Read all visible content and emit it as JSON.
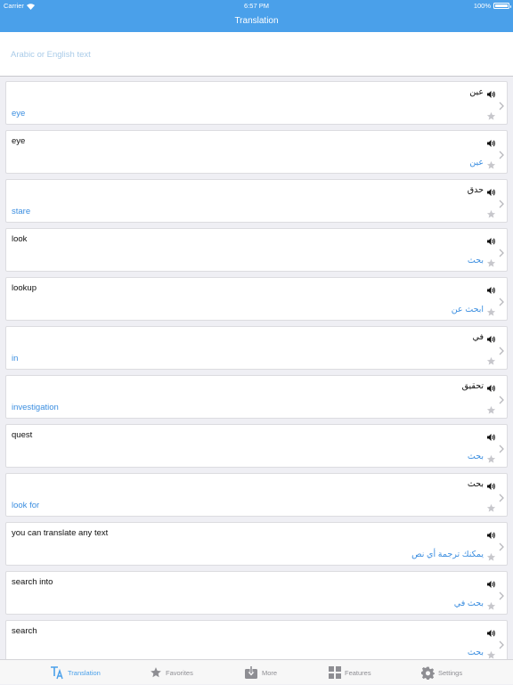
{
  "status_bar": {
    "carrier": "Carrier",
    "time": "6:57 PM",
    "battery": "100%"
  },
  "nav": {
    "title": "Translation"
  },
  "search": {
    "placeholder": "Arabic or English text",
    "value": ""
  },
  "colors": {
    "accent": "#4aa0ea",
    "translation_text": "#3b8ee0"
  },
  "entries": [
    {
      "source": "عين",
      "translation": "eye",
      "source_rtl": true
    },
    {
      "source": "eye",
      "translation": "عين",
      "source_rtl": false
    },
    {
      "source": "حدق",
      "translation": "stare",
      "source_rtl": true
    },
    {
      "source": "look",
      "translation": "بحث",
      "source_rtl": false
    },
    {
      "source": "lookup",
      "translation": "ابحث عن",
      "source_rtl": false
    },
    {
      "source": "في",
      "translation": "in",
      "source_rtl": true
    },
    {
      "source": "تحقيق",
      "translation": "investigation",
      "source_rtl": true
    },
    {
      "source": "quest",
      "translation": "بحث",
      "source_rtl": false
    },
    {
      "source": "بحث",
      "translation": "look for",
      "source_rtl": true
    },
    {
      "source": "you can translate any text",
      "translation": "يمكنك ترجمة أي نص",
      "source_rtl": false
    },
    {
      "source": "search into",
      "translation": "بحث في",
      "source_rtl": false
    },
    {
      "source": "search",
      "translation": "بحث",
      "source_rtl": false
    }
  ],
  "tabs": [
    {
      "label": "Translation",
      "icon": "translate-icon",
      "active": true
    },
    {
      "label": "Favorites",
      "icon": "star-icon",
      "active": false
    },
    {
      "label": "More",
      "icon": "download-icon",
      "active": false
    },
    {
      "label": "Features",
      "icon": "grid-icon",
      "active": false
    },
    {
      "label": "Settings",
      "icon": "gear-icon",
      "active": false
    }
  ]
}
